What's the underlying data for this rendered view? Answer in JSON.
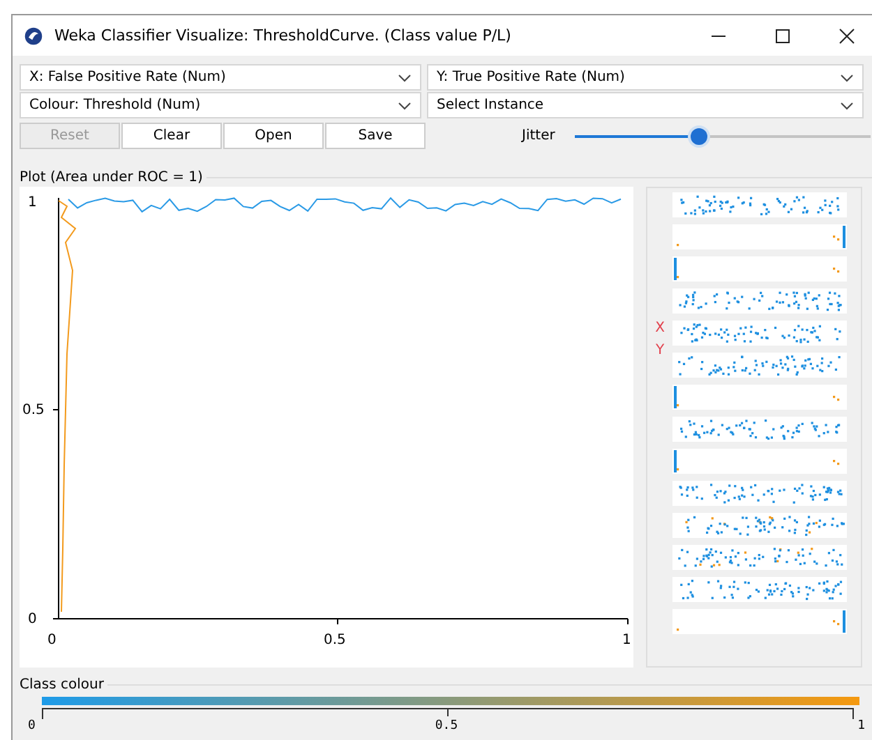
{
  "window": {
    "title": "Weka Classifier Visualize: ThresholdCurve. (Class value P/L)"
  },
  "selects": [
    {
      "value": "X: False Positive Rate (Num)"
    },
    {
      "value": "Y: True Positive Rate (Num)"
    },
    {
      "value": "Colour: Threshold (Num)"
    },
    {
      "value": "Select Instance"
    }
  ],
  "buttons": [
    {
      "label": "Reset",
      "disabled": true
    },
    {
      "label": "Clear",
      "disabled": false
    },
    {
      "label": "Open",
      "disabled": false
    },
    {
      "label": "Save",
      "disabled": false
    }
  ],
  "jitter": {
    "label": "Jitter",
    "level": 0.42
  },
  "plot": {
    "title": "Plot (Area under ROC = 1)",
    "y_ticks": [
      "1",
      "0.5",
      "0"
    ],
    "x_ticks": [
      "0",
      "0.5",
      "1"
    ]
  },
  "attribute_panel": {
    "x_marker": "X",
    "y_marker": "Y"
  },
  "class_colour": {
    "title": "Class colour",
    "ticks": [
      "0",
      "0.5",
      "1"
    ]
  }
}
